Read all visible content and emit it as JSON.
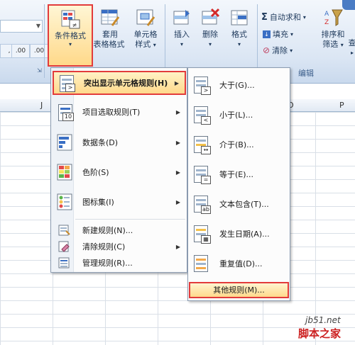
{
  "ribbon": {
    "number_group": {
      "increase_decimal": ".00",
      "decrease_decimal": ".00"
    },
    "styles_group": {
      "conditional_format": "条件格式",
      "table_format_line1": "套用",
      "table_format_line2": "表格格式",
      "cell_style_line1": "单元格",
      "cell_style_line2": "样式"
    },
    "cells_group": {
      "insert": "插入",
      "delete": "删除",
      "format": "格式"
    },
    "edit_group": {
      "autosum": "自动求和",
      "fill": "填充",
      "clear": "清除",
      "sort_filter_line1": "排序和",
      "sort_filter_line2": "筛选",
      "find_line1": "查",
      "label": "编辑"
    }
  },
  "sheet": {
    "columns": [
      "J",
      "O",
      "P"
    ]
  },
  "menu_main": {
    "items": [
      {
        "label": "突出显示单元格规则(H)",
        "has_submenu": true,
        "highlighted": true
      },
      {
        "label": "项目选取规则(T)",
        "has_submenu": true
      },
      {
        "label": "数据条(D)",
        "has_submenu": true
      },
      {
        "label": "色阶(S)",
        "has_submenu": true
      },
      {
        "label": "图标集(I)",
        "has_submenu": true
      },
      {
        "label": "新建规则(N)..."
      },
      {
        "label": "清除规则(C)",
        "has_submenu": true
      },
      {
        "label": "管理规则(R)..."
      }
    ]
  },
  "menu_sub": {
    "items": [
      {
        "label": "大于(G)...",
        "badge": ">"
      },
      {
        "label": "小于(L)...",
        "badge": "<"
      },
      {
        "label": "介于(B)...",
        "badge": "↔"
      },
      {
        "label": "等于(E)...",
        "badge": "="
      },
      {
        "label": "文本包含(T)...",
        "badge": "ab"
      },
      {
        "label": "发生日期(A)...",
        "badge": "▦"
      },
      {
        "label": "重复值(D)...",
        "badge": "≡"
      }
    ],
    "more_rules": "其他规则(M)..."
  },
  "watermark": {
    "site": "jb51.net",
    "brand": "脚本之家"
  },
  "colors": {
    "highlight_border": "#e23b3b",
    "highlight_fill": "#ffd98c"
  }
}
